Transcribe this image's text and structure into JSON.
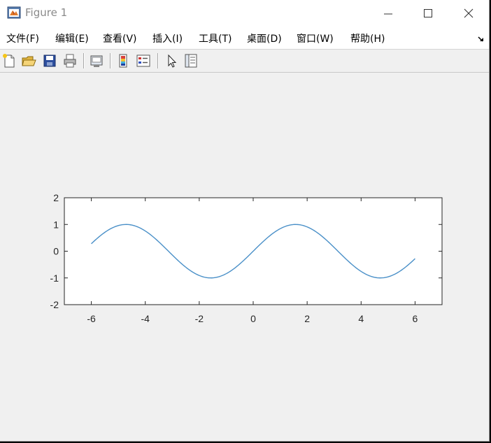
{
  "window": {
    "title": "Figure 1",
    "icon": "matlab-icon"
  },
  "controls": {
    "minimize_icon": "minimize-icon",
    "maximize_icon": "maximize-icon",
    "close_icon": "close-icon"
  },
  "menu": {
    "items": [
      {
        "label": "文件(F)",
        "name": "menu-file"
      },
      {
        "label": "编辑(E)",
        "name": "menu-edit"
      },
      {
        "label": "查看(V)",
        "name": "menu-view"
      },
      {
        "label": "插入(I)",
        "name": "menu-insert"
      },
      {
        "label": "工具(T)",
        "name": "menu-tools"
      },
      {
        "label": "桌面(D)",
        "name": "menu-desktop"
      },
      {
        "label": "窗口(W)",
        "name": "menu-window"
      },
      {
        "label": "帮助(H)",
        "name": "menu-help"
      }
    ],
    "dock_arrow_icon": "dock-arrow-icon"
  },
  "toolbar": {
    "buttons": [
      "new-figure-icon",
      "open-file-icon",
      "save-icon",
      "print-icon",
      "link-plot-icon",
      "insert-colorbar-icon",
      "insert-legend-icon",
      "edit-plot-icon",
      "property-inspector-icon"
    ]
  },
  "colors": {
    "line": "#4a90c8",
    "axes_bg": "#ffffff",
    "figure_bg": "#f0f0f0",
    "axis_color": "#262626"
  },
  "chart_data": {
    "type": "line",
    "function": "sin(x)",
    "x_range": [
      -6,
      6
    ],
    "xlim": [
      -7,
      7
    ],
    "ylim": [
      -2,
      2
    ],
    "xticks": [
      -6,
      -4,
      -2,
      0,
      2,
      4,
      6
    ],
    "yticks": [
      -2,
      -1,
      0,
      1,
      2
    ],
    "xtick_labels": [
      "-6",
      "-4",
      "-2",
      "0",
      "2",
      "4",
      "6"
    ],
    "ytick_labels": [
      "-2",
      "-1",
      "0",
      "1",
      "2"
    ],
    "title": "",
    "xlabel": "",
    "ylabel": "",
    "grid": false,
    "series": [
      {
        "x": [
          -6,
          -5.5,
          -5,
          -4.5,
          -4,
          -3.5,
          -3,
          -2.5,
          -2,
          -1.5,
          -1,
          -0.5,
          0,
          0.5,
          1,
          1.5,
          2,
          2.5,
          3,
          3.5,
          4,
          4.5,
          5,
          5.5,
          6
        ],
        "y": [
          0.279,
          0.706,
          0.959,
          0.978,
          0.757,
          0.351,
          -0.141,
          -0.598,
          -0.909,
          -0.997,
          -0.841,
          -0.479,
          0,
          0.479,
          0.841,
          0.997,
          0.909,
          0.598,
          0.141,
          -0.351,
          -0.757,
          -0.978,
          -0.959,
          -0.706,
          -0.279
        ]
      }
    ]
  }
}
